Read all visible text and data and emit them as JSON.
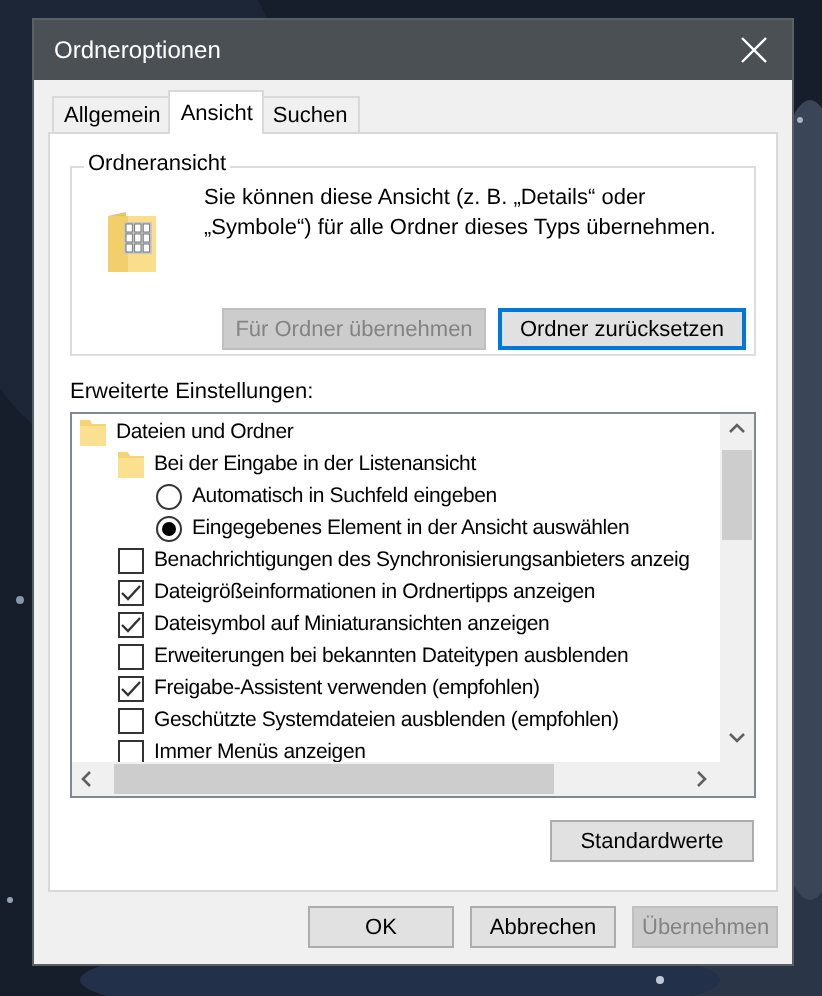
{
  "window": {
    "title": "Ordneroptionen"
  },
  "tabs": [
    {
      "label": "Allgemein",
      "selected": false
    },
    {
      "label": "Ansicht",
      "selected": true
    },
    {
      "label": "Suchen",
      "selected": false
    }
  ],
  "folder_view": {
    "title": "Ordneransicht",
    "description": "Sie können diese Ansicht (z. B. „Details“ oder „Symbole“) für alle Ordner dieses Typs übernehmen.",
    "buttons": [
      {
        "label": "Für Ordner übernehmen",
        "disabled": true
      },
      {
        "label": "Ordner zurücksetzen",
        "disabled": false
      }
    ]
  },
  "advanced": {
    "label": "Erweiterte Einstellungen:",
    "items": [
      {
        "kind": "folder",
        "label": "Dateien und Ordner",
        "children": [
          {
            "kind": "folder",
            "label": "Bei der Eingabe in der Listenansicht",
            "children": [
              {
                "kind": "radio",
                "label": "Automatisch in Suchfeld eingeben",
                "selected": false
              },
              {
                "kind": "radio",
                "label": "Eingegebenes Element in der Ansicht auswählen",
                "selected": true
              }
            ]
          },
          {
            "kind": "checkbox",
            "label": "Benachrichtigungen des Synchronisierungsanbieters anzeig",
            "checked": false
          },
          {
            "kind": "checkbox",
            "label": "Dateigrößeinformationen in Ordnertipps anzeigen",
            "checked": true
          },
          {
            "kind": "checkbox",
            "label": "Dateisymbol auf Miniaturansichten anzeigen",
            "checked": true
          },
          {
            "kind": "checkbox",
            "label": "Erweiterungen bei bekannten Dateitypen ausblenden",
            "checked": false
          },
          {
            "kind": "checkbox",
            "label": "Freigabe-Assistent verwenden (empfohlen)",
            "checked": true
          },
          {
            "kind": "checkbox",
            "label": "Geschützte Systemdateien ausblenden (empfohlen)",
            "checked": false
          },
          {
            "kind": "checkbox",
            "label": "Immer Menüs anzeigen",
            "checked": false
          }
        ]
      }
    ],
    "defaults_button": "Standardwerte"
  },
  "buttons": [
    {
      "label": "OK",
      "disabled": false
    },
    {
      "label": "Abbrechen",
      "disabled": false
    },
    {
      "label": "Übernehmen",
      "disabled": true
    }
  ]
}
